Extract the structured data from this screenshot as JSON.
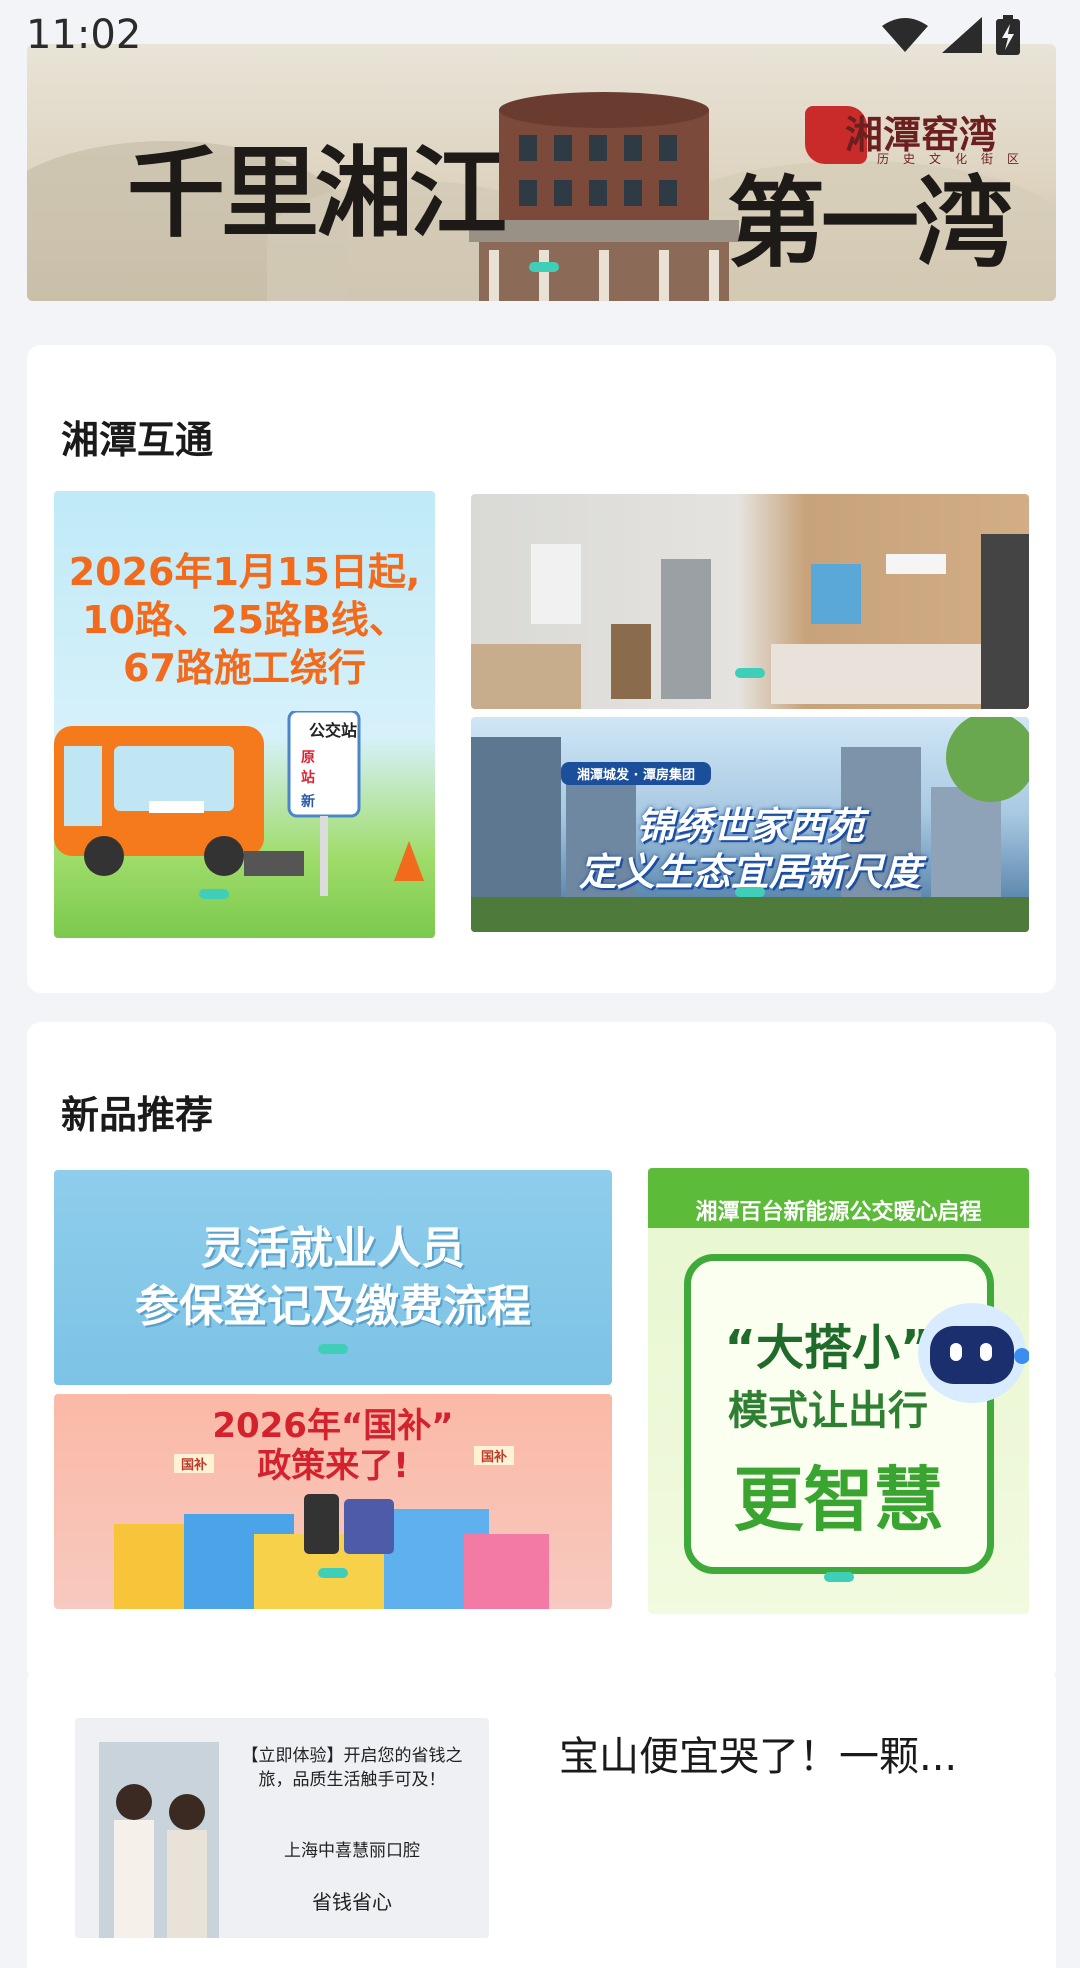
{
  "status_bar": {
    "time": "11:02"
  },
  "banner": {
    "title_left": "千里湘江",
    "title_right": "第一湾",
    "logo_text": "湘潭窑湾",
    "logo_sub": "历史文化街区"
  },
  "section_interconnect": {
    "title": "湘潭互通",
    "bus_notice": {
      "line1": "2026年1月15日起,",
      "line2": "10路、25路B线、",
      "line3": "67路施工绕行",
      "stop_sign": "公交站",
      "stop_orig": "原",
      "stop_station": "站",
      "stop_new": "新"
    },
    "housing_ad": {
      "tag": "湘潭城发 · 潭房集团",
      "line1": "锦绣世家西苑",
      "line2": "定义生态宜居新尺度"
    }
  },
  "section_new": {
    "title": "新品推荐",
    "insurance": {
      "line1": "灵活就业人员",
      "line2": "参保登记及缴费流程"
    },
    "subsidy": {
      "line1": "2026年“国补”",
      "line2": "政策来了!",
      "tag": "国补"
    },
    "bus_ad": {
      "header": "湘潭百台新能源公交暖心启程",
      "line1": "“大搭小”",
      "line2": "模式让出行",
      "line3": "更智慧"
    }
  },
  "feed": {
    "thumb_text1": "【立即体验】开启您的省钱之旅，品质生活触手可及！",
    "thumb_text2": "上海中喜慧丽口腔",
    "thumb_text3": "省钱省心",
    "title": "宝山便宜哭了！一颗..."
  },
  "colors": {
    "accent": "#3fcfb8",
    "card": "#ffffff",
    "background": "#f3f4f8"
  }
}
